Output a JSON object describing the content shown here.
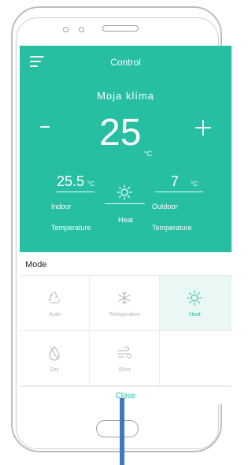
{
  "header": {
    "title": "Control"
  },
  "device": {
    "name": "Moja klíma"
  },
  "setpoint": {
    "value": "25",
    "unit": "°C",
    "minus_label": "-",
    "plus_label": "+"
  },
  "indoor": {
    "value": "25.5",
    "unit": "°C",
    "label_line1": "Indoor",
    "label_line2": "Temperature"
  },
  "current_mode": {
    "label": "Heat",
    "icon": "sun-icon"
  },
  "outdoor": {
    "value": "7",
    "unit": "°C",
    "label_line1": "Outdoor",
    "label_line2": "Temperature"
  },
  "mode_section": {
    "title": "Mode",
    "options": [
      {
        "label": "Auto",
        "icon": "recycle-icon",
        "selected": false
      },
      {
        "label": "Refrigeration",
        "icon": "snowflake-icon",
        "selected": false
      },
      {
        "label": "Heat",
        "icon": "sun-icon",
        "selected": true
      },
      {
        "label": "Dry",
        "icon": "drop-icon",
        "selected": false
      },
      {
        "label": "Blow",
        "icon": "wind-icon",
        "selected": false
      }
    ]
  },
  "footer": {
    "close_label": "Close"
  },
  "colors": {
    "accent": "#26bfa2",
    "selected_bg": "#e9f7f5",
    "muted": "#b5b5b5"
  }
}
